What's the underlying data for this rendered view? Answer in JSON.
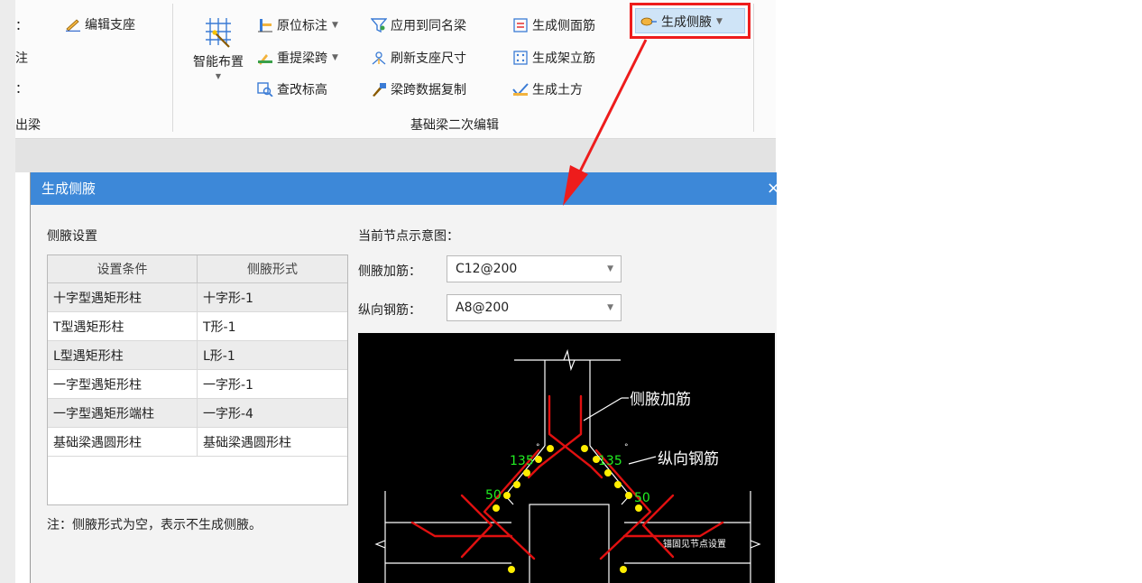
{
  "ribbon": {
    "partial_left": {
      "row1_tail": "：",
      "row2_tail": "注",
      "row3_tail": "：",
      "group_tail": "出梁"
    },
    "edit_support": "编辑支座",
    "smart_layout": "智能布置",
    "smart_caret": "▼",
    "col2": [
      "原位标注",
      "重提梁跨",
      "查改标高"
    ],
    "col3": [
      "应用到同名梁",
      "刷新支座尺寸",
      "梁跨数据复制"
    ],
    "col4": [
      "生成侧面筋",
      "生成架立筋",
      "生成土方"
    ],
    "highlight_button": "生成侧腋",
    "group_label": "基础梁二次编辑"
  },
  "dialog": {
    "title": "生成侧腋",
    "close": "×",
    "settings_label": "侧腋设置",
    "table": {
      "headers": [
        "设置条件",
        "侧腋形式"
      ],
      "rows": [
        [
          "十字型遇矩形柱",
          "十字形-1"
        ],
        [
          "T型遇矩形柱",
          "T形-1"
        ],
        [
          "L型遇矩形柱",
          "L形-1"
        ],
        [
          "一字型遇矩形柱",
          "一字形-1"
        ],
        [
          "一字型遇矩形端柱",
          "一字形-4"
        ],
        [
          "基础梁遇圆形柱",
          "基础梁遇圆形柱"
        ]
      ]
    },
    "note": "注：侧腋形式为空，表示不生成侧腋。",
    "preview_label": "当前节点示意图：",
    "haunch_bar_label": "侧腋加筋：",
    "haunch_bar_value": "C12@200",
    "long_bar_label": "纵向钢筋：",
    "long_bar_value": "A8@200",
    "diagram": {
      "label_haunch": "侧腋加筋",
      "label_long": "纵向钢筋",
      "angle_left": "135",
      "angle_right": "135",
      "degree": "°",
      "dim_left": "50",
      "dim_right": "50",
      "anchor_note": "锚固见节点设置"
    }
  },
  "colors": {
    "title_bar": "#3d88d8",
    "highlight_red": "#ee1c1c",
    "rebar_red": "#e01010",
    "dot_yellow": "#ffee00",
    "dim_green": "#22ee22"
  }
}
